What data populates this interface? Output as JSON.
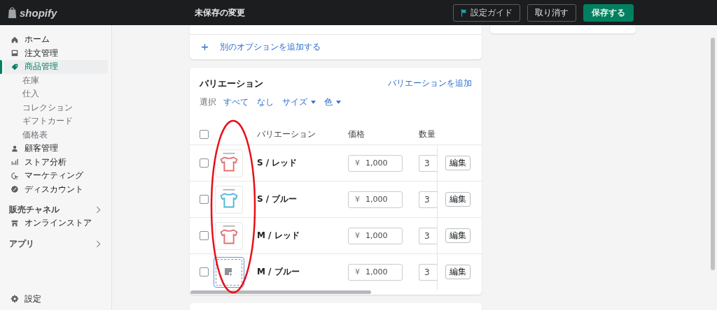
{
  "top_bar": {
    "logo": "shopify",
    "title": "未保存の変更",
    "buttons": [
      {
        "label": "設定ガイド",
        "kind": "guide"
      },
      {
        "label": "取り消す",
        "kind": "secondary"
      },
      {
        "label": "保存する",
        "kind": "primary"
      }
    ]
  },
  "sidebar": {
    "items": [
      {
        "label": "ホーム",
        "kind": "home",
        "selected": false
      },
      {
        "label": "注文管理",
        "kind": "inbox",
        "selected": false
      },
      {
        "label": "商品管理",
        "kind": "tag",
        "selected": true,
        "children": [
          {
            "label": "在庫",
            "selected": false
          },
          {
            "label": "仕入",
            "selected": false
          },
          {
            "label": "コレクション",
            "selected": false
          },
          {
            "label": "ギフトカード",
            "selected": false
          },
          {
            "label": "価格表",
            "selected": false
          }
        ]
      },
      {
        "label": "顧客管理",
        "kind": "person",
        "selected": false
      },
      {
        "label": "ストア分析",
        "kind": "bars",
        "selected": false
      },
      {
        "label": "マーケティング",
        "kind": "target",
        "selected": false
      },
      {
        "label": "ディスカウント",
        "kind": "discount",
        "selected": false
      }
    ],
    "sections": [
      {
        "label": "販売チャネル",
        "items": [
          {
            "label": "オンラインストア",
            "kind": "store",
            "selected": false
          }
        ]
      },
      {
        "label": "アプリ"
      }
    ],
    "settings": {
      "label": "設定"
    }
  },
  "options_card": {
    "add_option": "別のオプションを追加する"
  },
  "variants_card": {
    "title": "バリエーション",
    "add_link": "バリエーションを追加",
    "select_label": "選択",
    "filters": [
      {
        "label": "すべて",
        "dropdown": false
      },
      {
        "label": "なし",
        "dropdown": false
      },
      {
        "label": "サイズ",
        "dropdown": true
      },
      {
        "label": "色",
        "dropdown": true
      }
    ],
    "header_checked": false,
    "columns": [
      "バリエーション",
      "価格",
      "数量"
    ],
    "rows": [
      {
        "checked": false,
        "image": {
          "kind": "shirt",
          "color": "#e07070"
        },
        "name": "S / レッド",
        "currency": "¥",
        "price": "1,000",
        "quantity": "3",
        "edit": "編集"
      },
      {
        "checked": false,
        "image": {
          "kind": "shirt",
          "color": "#4fb6d8"
        },
        "name": "S / ブルー",
        "currency": "¥",
        "price": "1,000",
        "quantity": "3",
        "edit": "編集"
      },
      {
        "checked": false,
        "image": {
          "kind": "shirt",
          "color": "#e07070"
        },
        "name": "M / レッド",
        "currency": "¥",
        "price": "1,000",
        "quantity": "3",
        "edit": "編集"
      },
      {
        "checked": false,
        "image": {
          "kind": "placeholder"
        },
        "name": "M / ブルー",
        "currency": "¥",
        "price": "1,000",
        "quantity": "3",
        "edit": "編集"
      }
    ],
    "highlight_ellipse": true
  }
}
